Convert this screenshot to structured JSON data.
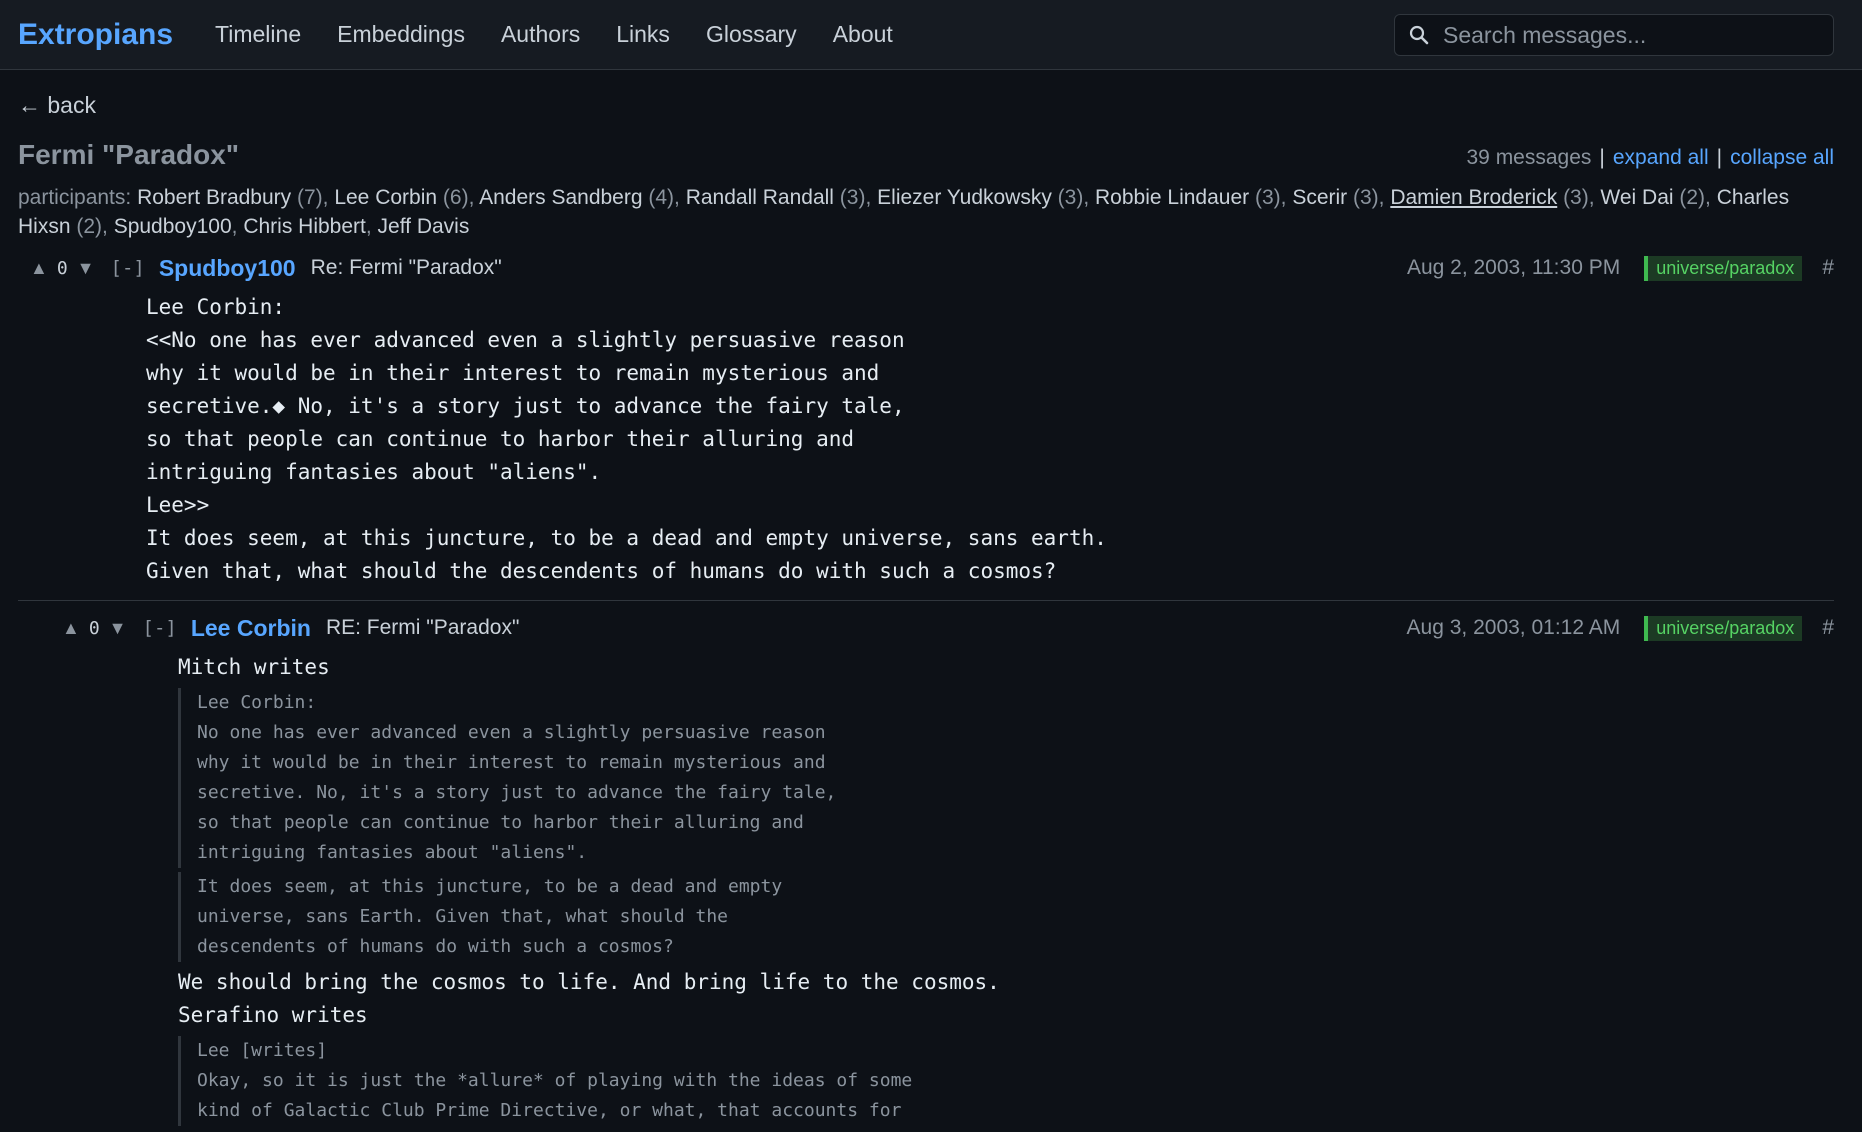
{
  "nav": {
    "brand": "Extropians",
    "items": [
      "Timeline",
      "Embeddings",
      "Authors",
      "Links",
      "Glossary",
      "About"
    ],
    "search_placeholder": "Search messages..."
  },
  "page": {
    "back_label": "← back",
    "title": "Fermi \"Paradox\"",
    "message_count": "39 messages",
    "expand_all": "expand all",
    "collapse_all": "collapse all",
    "participants_label": "participants:",
    "participants": [
      {
        "name": "Robert Bradbury",
        "count": " (7)"
      },
      {
        "name": "Lee Corbin",
        "count": " (6)"
      },
      {
        "name": "Anders Sandberg",
        "count": " (4)"
      },
      {
        "name": "Randall Randall",
        "count": " (3)"
      },
      {
        "name": "Eliezer Yudkowsky",
        "count": " (3)"
      },
      {
        "name": "Robbie Lindauer",
        "count": " (3)"
      },
      {
        "name": "Scerir",
        "count": " (3)"
      },
      {
        "name": "Damien Broderick",
        "count": " (3)"
      },
      {
        "name": "Wei Dai",
        "count": " (2)"
      },
      {
        "name": "Charles Hixsn",
        "count": " (2)"
      },
      {
        "name": "Spudboy100",
        "count": ""
      },
      {
        "name": "Chris Hibbert",
        "count": ""
      },
      {
        "name": "Jeff Davis",
        "count": ""
      }
    ]
  },
  "messages": [
    {
      "votes": "0",
      "collapse": "[-]",
      "author": "Spudboy100",
      "subject": "Re: Fermi \"Paradox\"",
      "date": "Aug 2, 2003, 11:30 PM",
      "tag": "universe/paradox",
      "hash": "#",
      "body": "Lee Corbin:\n<<No one has ever advanced even a slightly persuasive reason\nwhy it would be in their interest to remain mysterious and\nsecretive.◆ No, it's a story just to advance the fairy tale,\nso that people can continue to harbor their alluring and\nintriguing fantasies about \"aliens\".\nLee>>\nIt does seem, at this juncture, to be a dead and empty universe, sans earth.\nGiven that, what should the descendents of humans do with such a cosmos?"
    },
    {
      "votes": "0",
      "collapse": "[-]",
      "author": "Lee Corbin",
      "subject": "RE: Fermi \"Paradox\"",
      "date": "Aug 3, 2003, 01:12 AM",
      "tag": "universe/paradox",
      "hash": "#",
      "intro": "Mitch writes",
      "quote1": "Lee Corbin:\nNo one has ever advanced even a slightly persuasive reason\nwhy it would be in their interest to remain mysterious and\nsecretive. No, it's a story just to advance the fairy tale,\nso that people can continue to harbor their alluring and\nintriguing fantasies about \"aliens\".",
      "quote2": "It does seem, at this juncture, to be a dead and empty\nuniverse, sans Earth. Given that, what should the\ndescendents of humans do with such a cosmos?",
      "reply1": "We should bring the cosmos to life. And bring life to the cosmos.",
      "intro2": "Serafino writes",
      "quote3": "Lee [writes]\nOkay, so it is just the *allure* of playing with the ideas of some\nkind of Galactic Club Prime Directive, or what, that accounts for"
    }
  ]
}
